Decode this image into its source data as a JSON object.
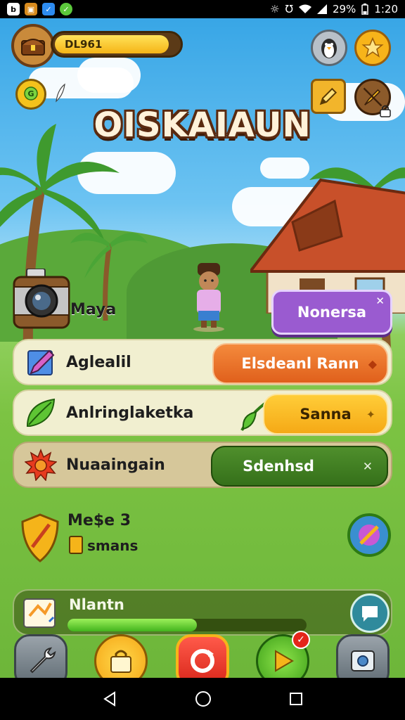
{
  "status_bar": {
    "app_icons": [
      "notification-icon",
      "shop-app-icon",
      "messenger-icon",
      "chat-app-icon"
    ],
    "battery": "29%",
    "time": "1:20"
  },
  "hud": {
    "player_level_label": "DL961",
    "title": "OISKAIAUN"
  },
  "character": {
    "name": "Maya",
    "action_button": "Nonersa"
  },
  "menu": {
    "rows": [
      {
        "label": "Aglealil",
        "button": "Elsdeanl Rann"
      },
      {
        "label": "Anlringlaketka",
        "button": "Sanna"
      },
      {
        "label": "Nuaaingain",
        "button": "Sdenhsd"
      }
    ]
  },
  "mission": {
    "title": "Me$e 3",
    "subtitle": "smans"
  },
  "progress": {
    "label": "Nlantn",
    "value": 0.54
  },
  "colors": {
    "accent_orange": "#e96f23",
    "accent_yellow": "#f6b81a",
    "accent_green": "#3d7a22",
    "accent_purple": "#9a5bd0",
    "gold": "#f5b416"
  }
}
